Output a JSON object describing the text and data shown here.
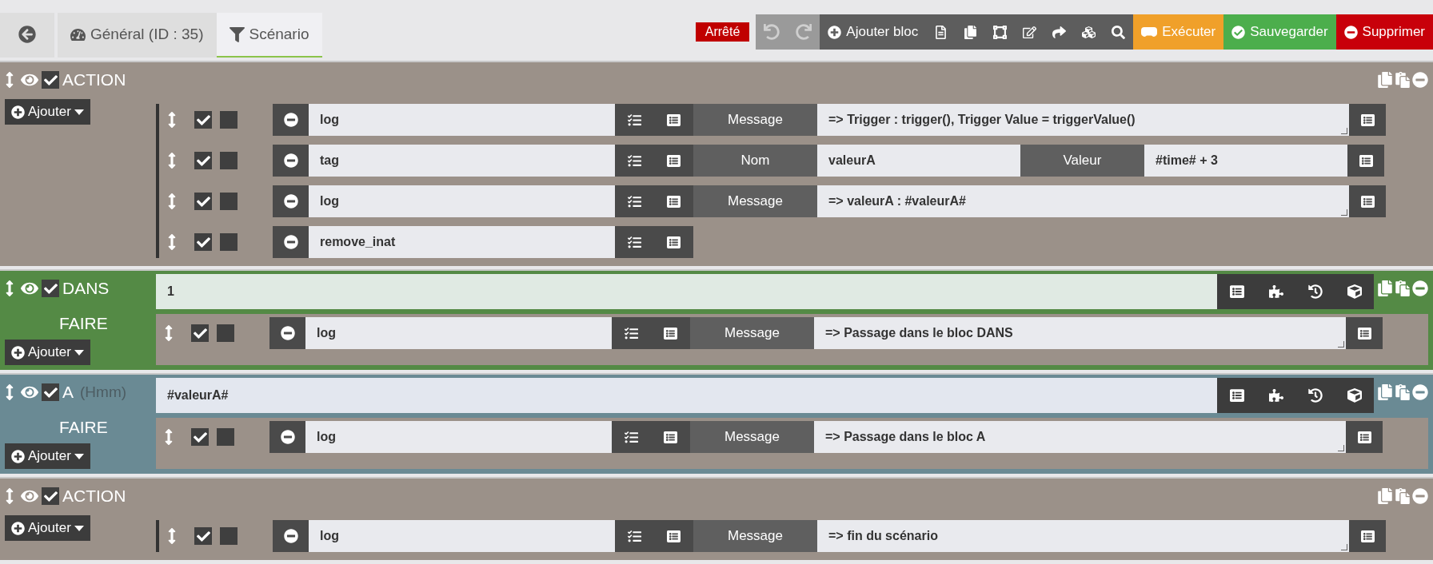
{
  "tabs": [
    {
      "kind": "back",
      "selected": false
    },
    {
      "kind": "general",
      "label": "Général (ID : 35)",
      "selected": false
    },
    {
      "kind": "scenario",
      "label": "Scénario",
      "selected": true
    }
  ],
  "status": "Arrêté",
  "toolbar": {
    "history": [
      {
        "kind": "undo",
        "disabled": true
      },
      {
        "kind": "redo",
        "disabled": true
      }
    ],
    "add_label": "Ajouter bloc",
    "execute": "Exécuter",
    "save": "Sauvegarder",
    "delete": "Supprimer"
  },
  "blocks": [
    {
      "kind": "action",
      "title": "ACTION",
      "enabled": true,
      "add_label": "Ajouter",
      "actions": [
        {
          "name": "log",
          "enabled": true,
          "parallel": false,
          "fields": [
            {
              "label": "Message",
              "value": "=> Trigger : trigger(), Trigger Value = triggerValue()",
              "multiline": true
            }
          ]
        },
        {
          "name": "tag",
          "enabled": true,
          "parallel": false,
          "fields": [
            {
              "label": "Nom",
              "value": "valeurA",
              "multiline": false
            },
            {
              "label": "Valeur",
              "value": "#time# + 3",
              "multiline": false
            }
          ]
        },
        {
          "name": "log",
          "enabled": true,
          "parallel": false,
          "fields": [
            {
              "label": "Message",
              "value": "=> valeurA : #valeurA#",
              "multiline": true
            }
          ]
        },
        {
          "name": "remove_inat",
          "enabled": true,
          "parallel": false
        }
      ]
    },
    {
      "kind": "in",
      "title": "DANS",
      "enabled": true,
      "condition": "1",
      "do_label": "FAIRE",
      "add_label": "Ajouter",
      "actions": [
        {
          "name": "log",
          "enabled": true,
          "parallel": false,
          "fields": [
            {
              "label": "Message",
              "value": "=> Passage dans le bloc DANS",
              "multiline": true
            }
          ]
        }
      ]
    },
    {
      "kind": "at",
      "title": "A",
      "subtitle": "(Hmm)",
      "enabled": true,
      "condition": "#valeurA#",
      "do_label": "FAIRE",
      "add_label": "Ajouter",
      "actions": [
        {
          "name": "log",
          "enabled": true,
          "parallel": false,
          "fields": [
            {
              "label": "Message",
              "value": "=> Passage dans le bloc A",
              "multiline": true
            }
          ]
        }
      ]
    },
    {
      "kind": "action",
      "title": "ACTION",
      "enabled": true,
      "add_label": "Ajouter",
      "actions": [
        {
          "name": "log",
          "enabled": true,
          "parallel": false,
          "fields": [
            {
              "label": "Message",
              "value": "=> fin du scénario",
              "multiline": true
            }
          ]
        }
      ]
    }
  ]
}
